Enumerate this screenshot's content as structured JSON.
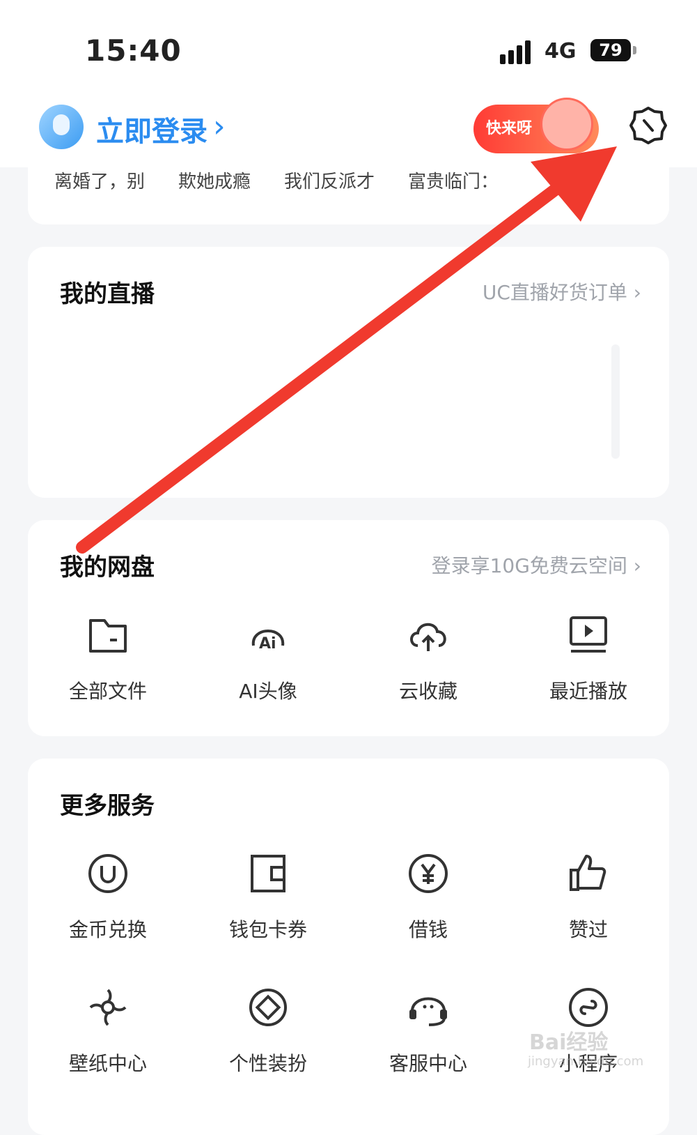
{
  "status_bar": {
    "time": "15:40",
    "network": "4G",
    "battery": "79"
  },
  "header": {
    "login_label": "立即登录",
    "login_chevron": "›",
    "promo_label": "快来呀",
    "settings_icon": "gear-icon"
  },
  "news": {
    "items": [
      "离婚了，别",
      "欺她成瘾",
      "我们反派才",
      "富贵临门："
    ]
  },
  "live": {
    "title": "我的直播",
    "link": "UC直播好货订单 ›"
  },
  "cloud": {
    "title": "我的网盘",
    "link": "登录享10G免费云空间 ›",
    "items": [
      {
        "label": "全部文件",
        "icon": "folder-icon"
      },
      {
        "label": "AI头像",
        "icon": "ai-avatar-icon"
      },
      {
        "label": "云收藏",
        "icon": "cloud-upload-icon"
      },
      {
        "label": "最近播放",
        "icon": "play-monitor-icon"
      }
    ]
  },
  "services": {
    "title": "更多服务",
    "items": [
      {
        "label": "金币兑换",
        "icon": "coin-icon"
      },
      {
        "label": "钱包卡券",
        "icon": "wallet-icon"
      },
      {
        "label": "借钱",
        "icon": "yen-icon"
      },
      {
        "label": "赞过",
        "icon": "thumbs-up-icon"
      },
      {
        "label": "壁纸中心",
        "icon": "wallpaper-icon"
      },
      {
        "label": "个性装扮",
        "icon": "theme-icon"
      },
      {
        "label": "客服中心",
        "icon": "headset-icon"
      },
      {
        "label": "小程序",
        "icon": "mini-program-icon"
      }
    ]
  },
  "watermark": {
    "brand": "Bai经验",
    "url": "jingyan.baidu.com"
  },
  "colors": {
    "accent": "#2b8cf0",
    "arrow": "#f03a2e"
  }
}
